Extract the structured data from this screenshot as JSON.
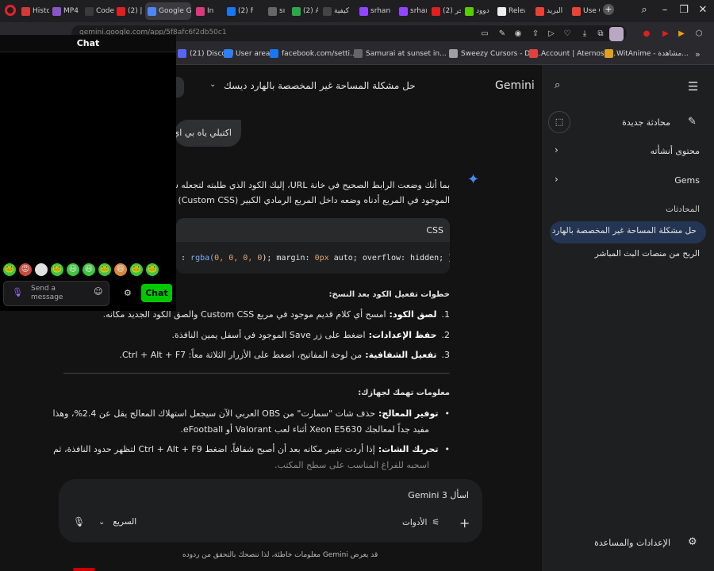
{
  "browser": {
    "tabs": [
      {
        "label": "Histo",
        "icon": "history-icon",
        "color": "#d23a3a"
      },
      {
        "label": "MP4",
        "icon": "mp4-icon",
        "color": "#8a55c7"
      },
      {
        "label": "Code",
        "icon": "code-icon",
        "color": "#3a3a3a"
      },
      {
        "label": "(2) إ",
        "icon": "youtube-icon",
        "color": "#e02020"
      },
      {
        "label": "Google G",
        "icon": "gemini-tab-icon",
        "color": "#4e86f7",
        "active": true
      },
      {
        "label": "In",
        "icon": "instagram-icon",
        "color": "#d93a7a"
      },
      {
        "label": "(2) F",
        "icon": "facebook-icon",
        "color": "#1877f2"
      },
      {
        "label": "sı",
        "icon": "speaker-icon",
        "color": "#666666"
      },
      {
        "label": "(2) Ai",
        "icon": "ai-icon",
        "color": "#2aa84a"
      },
      {
        "label": "كيفية",
        "icon": "cross-icon",
        "color": "#444444"
      },
      {
        "label": "srhan",
        "icon": "twitch-icon",
        "color": "#9146ff"
      },
      {
        "label": "srhan",
        "icon": "twitch-icon",
        "color": "#9146ff"
      },
      {
        "label": "(2) جر",
        "icon": "youtube-icon",
        "color": "#e02020"
      },
      {
        "label": "دوود",
        "icon": "duo-icon",
        "color": "#58cc02"
      },
      {
        "label": "Relea",
        "icon": "github-icon",
        "color": "#eeeeee"
      },
      {
        "label": "البريد",
        "icon": "gmail-icon",
        "color": "#ea4335"
      },
      {
        "label": "Use C",
        "icon": "gmail-icon",
        "color": "#ea4335"
      }
    ],
    "new_tab_glyph": "+",
    "url": "gemini.google.com/app/5f8afc6f2db50c1",
    "bookmarks": [
      {
        "label": "(21) Discord",
        "icon": "discord-icon"
      },
      {
        "label": "User area",
        "icon": "user-area-icon"
      },
      {
        "label": "facebook.com/setti...",
        "icon": "facebook-icon"
      },
      {
        "label": "Samurai at sunset in...",
        "icon": "globe-icon"
      },
      {
        "label": "Sweezy Cursors - Do...",
        "icon": "cursor-icon"
      },
      {
        "label": "Account | Aternos |...",
        "icon": "aternos-icon"
      },
      {
        "label": "WitAnime - مشاهدة...",
        "icon": "witanime-icon"
      }
    ]
  },
  "chat_overlay": {
    "title": "Chat",
    "input_placeholder": "Send a message",
    "send_label": "Chat",
    "emotes": [
      "🐸",
      "😡",
      "😵",
      "🐸",
      "😃",
      "😆",
      "🐸",
      "😄",
      "🐸",
      "🐸"
    ]
  },
  "gemini": {
    "brand": "Gemini",
    "conversation_title": "حل مشكلة المساحة غير المخصصة بالهارد ديسك",
    "user_message": "اكتبلي ياه بي اي",
    "response": {
      "intro_line1": "بما أنك وضعت الرابط الصحيح في خانة URL، إليك الكود الذي طلبته لتجعله شفافاً",
      "intro_line2": "الموجود في المربع أدناه وضعه داخل المربع الرمادي الكبير (Custom CSS) في الإعدادات",
      "code_lang": "CSS",
      "code_prefix": ": ",
      "code_fn": "rgba(",
      "code_args": "0, 0, 0, 0",
      "code_mid": "); margin: ",
      "code_zero": "0px",
      "code_tail": " auto; overflow: hidden; }",
      "steps_heading": "خطوات تفعيل الكود بعد النسخ:",
      "steps": [
        {
          "num": "1.",
          "bold": "لصق الكود:",
          "text": "امسح أي كلام قديم موجود في مربع Custom CSS والصق الكود الجديد مكانه."
        },
        {
          "num": "2.",
          "bold": "حفظ الإعدادات:",
          "text": "اضغط على زر Save الموجود في أسفل يمين النافذة."
        },
        {
          "num": "3.",
          "bold": "تفعيل الشفافية:",
          "text": "من لوحة المفاتيح، اضغط على الأزرار الثلاثة معاً: Ctrl + Alt + F7."
        }
      ],
      "info_heading": "معلومات تهمك لجهازك:",
      "bullets": [
        {
          "bold": "توفير المعالج:",
          "line1": "حذف شات \"سمارت\" من OBS العربي الآن سيجعل استهلاك المعالج يقل عن 2.4%، وهذا",
          "line2": "مفيد جداً لمعالجك Xeon E5630 أثناء لعب Valorant أو eFootball."
        },
        {
          "bold": "تحريك الشات:",
          "line1": "إذا أردت تغيير مكانه بعد أن أصبح شفافاً، اضغط Ctrl + Alt + F9 لتظهر حدود النافذة، ثم",
          "line2": "اسحبه للفراغ المناسب على سطح المكتب."
        }
      ]
    },
    "input": {
      "placeholder": "اسأل Gemini 3",
      "tools_label": "الأدوات",
      "model_label": "السريع"
    },
    "disclaimer": "قد يعرض Gemini معلومات خاطئة، لذا ننصحك بالتحقق من ردوده",
    "sidebar": {
      "new_chat": "محادثة جديدة",
      "my_content": "محتوى أنشأته",
      "gems": "Gems",
      "chats_heading": "المحادثات",
      "chats": [
        "حل مشكلة المساحة غير المخصصة بالهارد ديسك",
        "الربح من منصات البث المباشر"
      ],
      "settings": "الإعدادات والمساعدة"
    }
  },
  "colors": {
    "page_bg": "#131314",
    "sidebar_bg": "#1e1f20",
    "active_chat_bg": "#233552",
    "chat_send_green": "#00c800",
    "gemini_spark": "#4e86f7"
  }
}
